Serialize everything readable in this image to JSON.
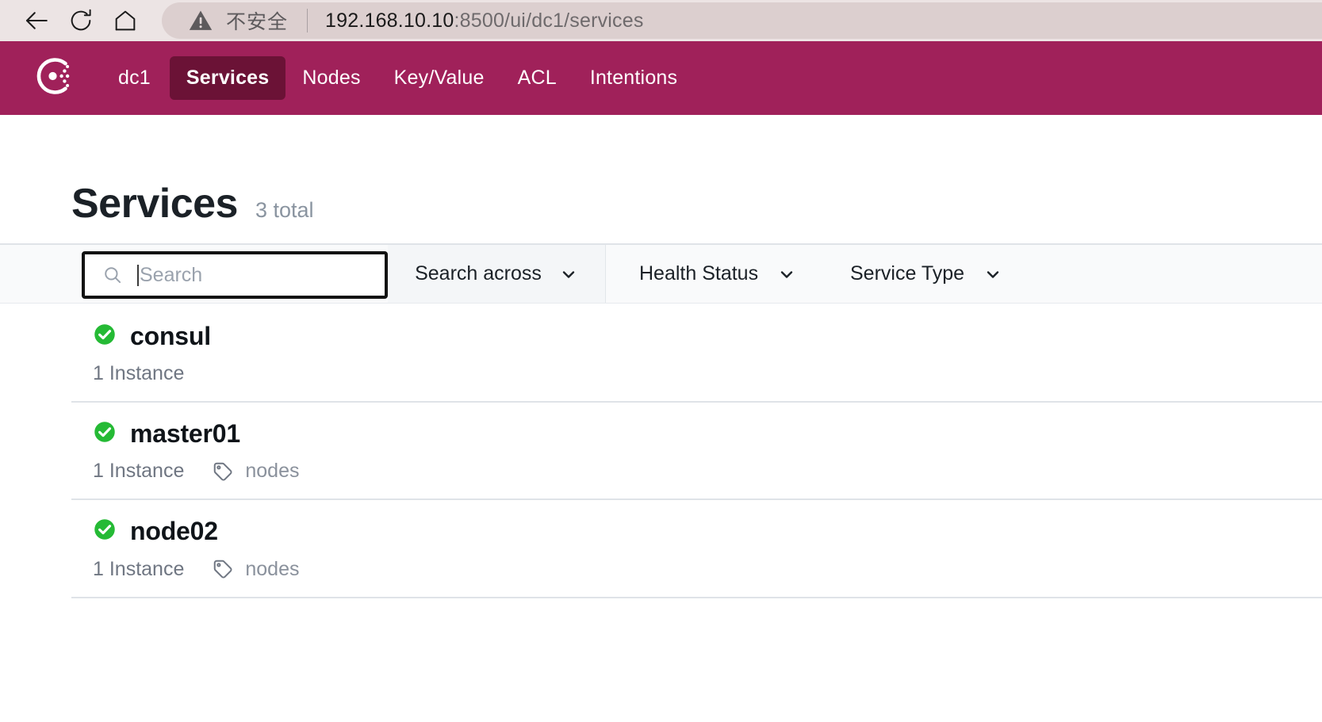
{
  "browser": {
    "back_icon": "arrow-left-icon",
    "reload_icon": "reload-icon",
    "home_icon": "home-icon",
    "security_icon": "warning-triangle-icon",
    "security_label": "不安全",
    "url_host": "192.168.10.10",
    "url_rest": ":8500/ui/dc1/services"
  },
  "nav": {
    "logo_name": "consul-logo",
    "items": [
      {
        "label": "dc1",
        "active": false
      },
      {
        "label": "Services",
        "active": true
      },
      {
        "label": "Nodes",
        "active": false
      },
      {
        "label": "Key/Value",
        "active": false
      },
      {
        "label": "ACL",
        "active": false
      },
      {
        "label": "Intentions",
        "active": false
      }
    ],
    "brand_color": "#a0215a",
    "active_color": "#6b1236"
  },
  "header": {
    "title": "Services",
    "total": "3 total"
  },
  "filters": {
    "search_placeholder": "Search",
    "search_value": "",
    "search_icon": "search-icon",
    "search_across_label": "Search across",
    "health_status_label": "Health Status",
    "service_type_label": "Service Type",
    "chevron_icon": "chevron-down-icon"
  },
  "services": [
    {
      "name": "consul",
      "health": "passing",
      "health_icon": "check-circle-icon",
      "health_color": "#25ba35",
      "instances": "1 Instance",
      "tags": []
    },
    {
      "name": "master01",
      "health": "passing",
      "health_icon": "check-circle-icon",
      "health_color": "#25ba35",
      "instances": "1 Instance",
      "tags": [
        "nodes"
      ]
    },
    {
      "name": "node02",
      "health": "passing",
      "health_icon": "check-circle-icon",
      "health_color": "#25ba35",
      "instances": "1 Instance",
      "tags": [
        "nodes"
      ]
    }
  ]
}
